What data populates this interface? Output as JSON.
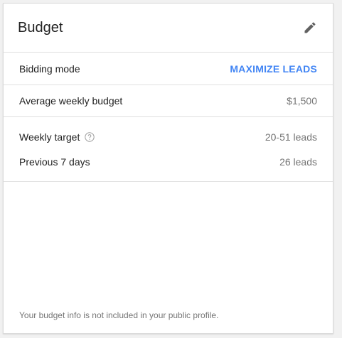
{
  "card": {
    "title": "Budget",
    "edit_icon": "pencil-icon"
  },
  "bidding": {
    "label": "Bidding mode",
    "value": "MAXIMIZE LEADS",
    "value_color": "#4285f4"
  },
  "budget": {
    "label": "Average weekly budget",
    "value": "$1,500"
  },
  "target": {
    "label": "Weekly target",
    "help_icon": "help-circle-icon",
    "value": "20-51 leads"
  },
  "previous": {
    "label": "Previous 7 days",
    "value": "26 leads"
  },
  "footer": {
    "note": "Your budget info is not included in your public profile."
  }
}
